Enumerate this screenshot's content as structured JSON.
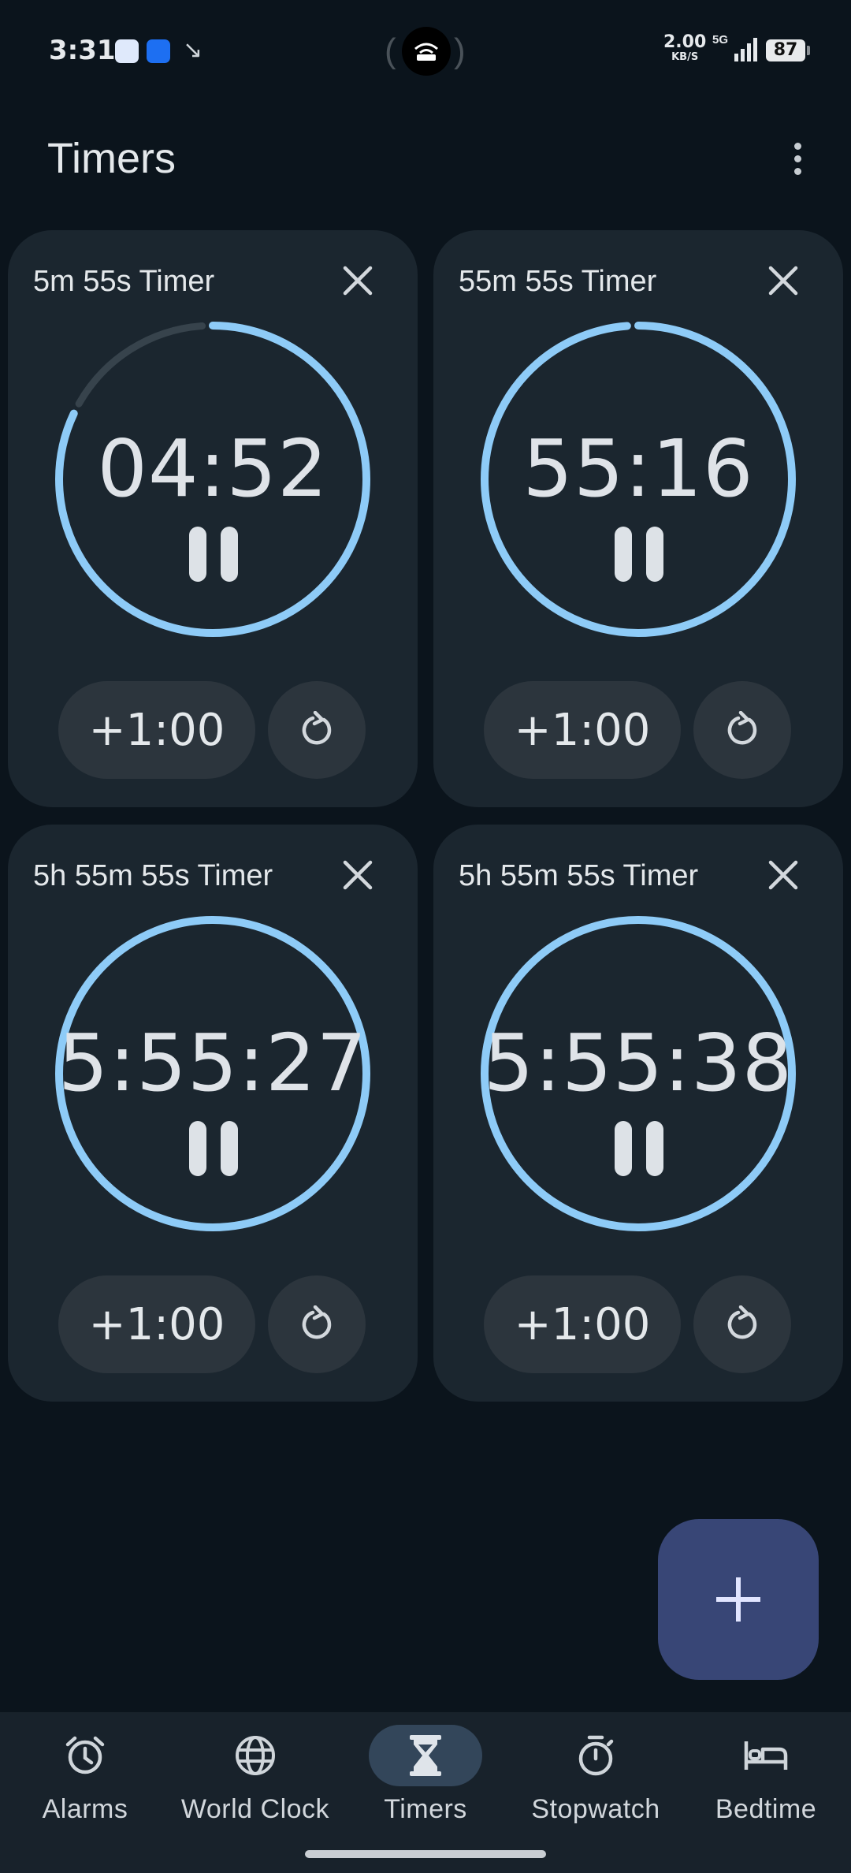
{
  "status_bar": {
    "time": "3:31",
    "speed_value": "2.00",
    "speed_unit": "KB/S",
    "network": "5G",
    "battery": "87"
  },
  "header": {
    "title": "Timers",
    "more_icon": "more-vert-icon"
  },
  "timers": [
    {
      "label": "5m 55s Timer",
      "time": "04:52",
      "add_label": "+1:00",
      "progress": 0.82
    },
    {
      "label": "55m 55s Timer",
      "time": "55:16",
      "add_label": "+1:00",
      "progress": 0.988
    },
    {
      "label": "5h 55m 55s Timer",
      "time": "5:55:27",
      "add_label": "+1:00",
      "progress": 0.999
    },
    {
      "label": "5h 55m 55s Timer",
      "time": "5:55:38",
      "add_label": "+1:00",
      "progress": 0.9995
    }
  ],
  "fab": {
    "icon": "plus-icon"
  },
  "nav": {
    "items": [
      {
        "label": "Alarms",
        "icon": "alarm-icon"
      },
      {
        "label": "World Clock",
        "icon": "globe-icon"
      },
      {
        "label": "Timers",
        "icon": "hourglass-icon",
        "active": true
      },
      {
        "label": "Stopwatch",
        "icon": "stopwatch-icon"
      },
      {
        "label": "Bedtime",
        "icon": "bed-icon"
      }
    ]
  },
  "colors": {
    "background": "#0b141c",
    "card": "#1b262f",
    "ring": "#8ecbf7",
    "ring_track": "#37434c",
    "fab": "#384676",
    "nav_active": "#33465a"
  }
}
